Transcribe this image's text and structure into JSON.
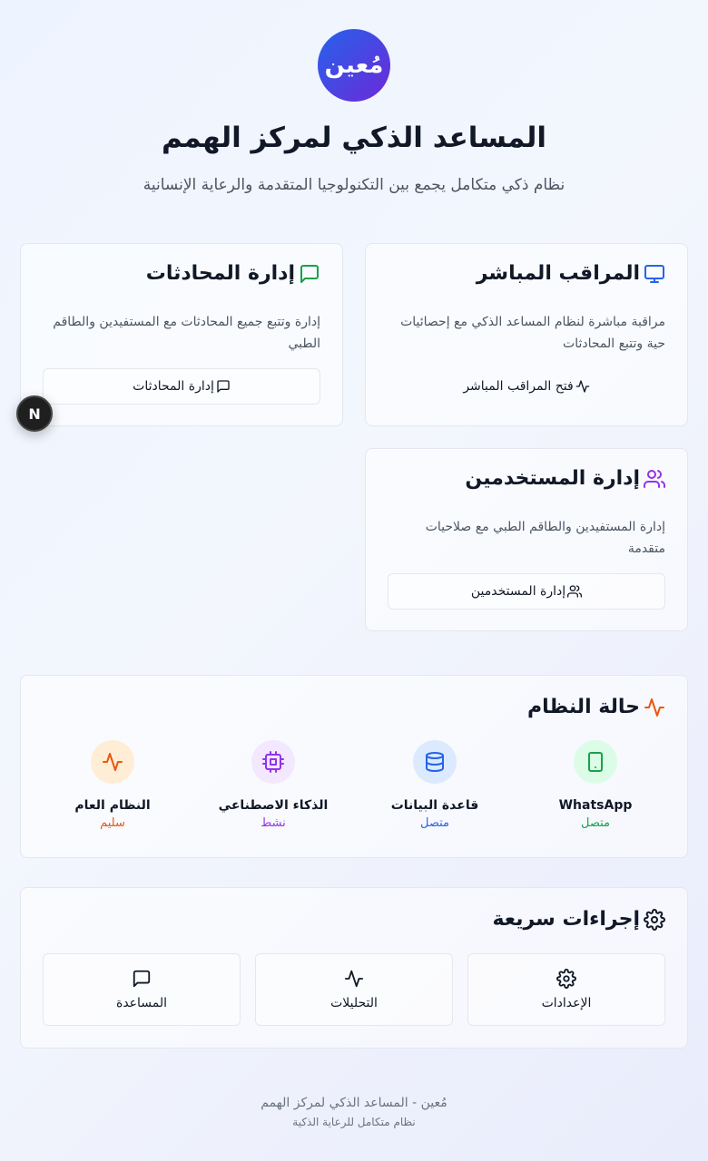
{
  "brand": {
    "logo_text": "مُعين"
  },
  "header": {
    "title": "المساعد الذكي لمركز الهمم",
    "subtitle": "نظام ذكي متكامل يجمع بين التكنولوجيا المتقدمة والرعاية الإنسانية"
  },
  "cards": {
    "monitor": {
      "title": "المراقب المباشر",
      "description": "مراقبة مباشرة لنظام المساعد الذكي مع إحصائيات حية وتتبع المحادثات",
      "button": "فتح المراقب المباشر",
      "icon": "monitor-icon",
      "color": "#2563eb"
    },
    "conversations": {
      "title": "إدارة المحادثات",
      "description": "إدارة وتتبع جميع المحادثات مع المستفيدين والطاقم الطبي",
      "button": "إدارة المحادثات",
      "icon": "message-icon",
      "color": "#16a34a"
    },
    "users": {
      "title": "إدارة المستخدمين",
      "description": "إدارة المستفيدين والطاقم الطبي مع صلاحيات متقدمة",
      "button": "إدارة المستخدمين",
      "icon": "users-icon",
      "color": "#9333ea"
    }
  },
  "dev_badge": {
    "label": "N"
  },
  "system_status": {
    "title": "حالة النظام",
    "items": [
      {
        "name": "WhatsApp",
        "status": "متصل",
        "icon": "smartphone-icon",
        "color": "#16a34a",
        "bg": "#dcfce7"
      },
      {
        "name": "قاعدة البيانات",
        "status": "متصل",
        "icon": "database-icon",
        "color": "#2563eb",
        "bg": "#dbeafe"
      },
      {
        "name": "الذكاء الاصطناعي",
        "status": "نشط",
        "icon": "cpu-icon",
        "color": "#9333ea",
        "bg": "#f3e8ff"
      },
      {
        "name": "النظام العام",
        "status": "سليم",
        "icon": "activity-icon",
        "color": "#ea580c",
        "bg": "#ffedd5"
      }
    ]
  },
  "quick_actions": {
    "title": "إجراءات سريعة",
    "items": [
      {
        "label": "الإعدادات",
        "icon": "settings-icon"
      },
      {
        "label": "التحليلات",
        "icon": "activity-icon"
      },
      {
        "label": "المساعدة",
        "icon": "message-icon"
      }
    ]
  },
  "footer": {
    "line1": "مُعين - المساعد الذكي لمركز الهمم",
    "line2": "نظام متكامل للرعاية الذكية"
  }
}
